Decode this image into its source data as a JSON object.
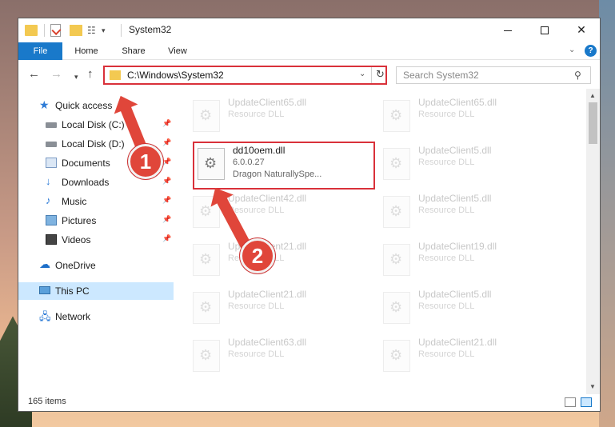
{
  "window": {
    "title": "System32"
  },
  "ribbon": {
    "tabs": [
      "File",
      "Home",
      "Share",
      "View"
    ]
  },
  "navigation": {
    "address": "C:\\Windows\\System32",
    "search_placeholder": "Search System32"
  },
  "sidebar": {
    "items": [
      {
        "label": "Quick access",
        "icon": "star-icon",
        "pinned": false
      },
      {
        "label": "Local Disk (C:)",
        "icon": "drive-icon",
        "pinned": true
      },
      {
        "label": "Local Disk (D:)",
        "icon": "drive-icon",
        "pinned": true
      },
      {
        "label": "Documents",
        "icon": "documents-icon",
        "pinned": true
      },
      {
        "label": "Downloads",
        "icon": "download-icon",
        "pinned": true
      },
      {
        "label": "Music",
        "icon": "music-icon",
        "pinned": true
      },
      {
        "label": "Pictures",
        "icon": "pictures-icon",
        "pinned": true
      },
      {
        "label": "Videos",
        "icon": "videos-icon",
        "pinned": true
      },
      {
        "label": "OneDrive",
        "icon": "onedrive-icon",
        "pinned": false
      },
      {
        "label": "This PC",
        "icon": "pc-icon",
        "pinned": false,
        "selected": true
      },
      {
        "label": "Network",
        "icon": "network-icon",
        "pinned": false
      }
    ]
  },
  "files": {
    "left_column": [
      {
        "name": "UpdateClient65.dll",
        "type": "Resource DLL"
      },
      {
        "name": "dd10oem.dll",
        "version": "6.0.0.27",
        "description": "Dragon NaturallySpe...",
        "highlighted": true
      },
      {
        "name": "UpdateClient42.dll",
        "type": "Resource DLL"
      },
      {
        "name": "UpdateClient21.dll",
        "type": "Resource DLL"
      },
      {
        "name": "UpdateClient21.dll",
        "type": "Resource DLL"
      },
      {
        "name": "UpdateClient63.dll",
        "type": "Resource DLL"
      }
    ],
    "right_column": [
      {
        "name": "UpdateClient65.dll",
        "type": "Resource DLL"
      },
      {
        "name": "UpdateClient5.dll",
        "type": "Resource DLL"
      },
      {
        "name": "UpdateClient5.dll",
        "type": "Resource DLL"
      },
      {
        "name": "UpdateClient19.dll",
        "type": "Resource DLL"
      },
      {
        "name": "UpdateClient5.dll",
        "type": "Resource DLL"
      },
      {
        "name": "UpdateClient21.dll",
        "type": "Resource DLL"
      }
    ]
  },
  "status": {
    "item_count": "165 items"
  },
  "annotations": {
    "step1": "1",
    "step2": "2"
  },
  "colors": {
    "accent": "#1979ca",
    "highlight_box": "#d9313a",
    "annotation": "#e0463a"
  }
}
